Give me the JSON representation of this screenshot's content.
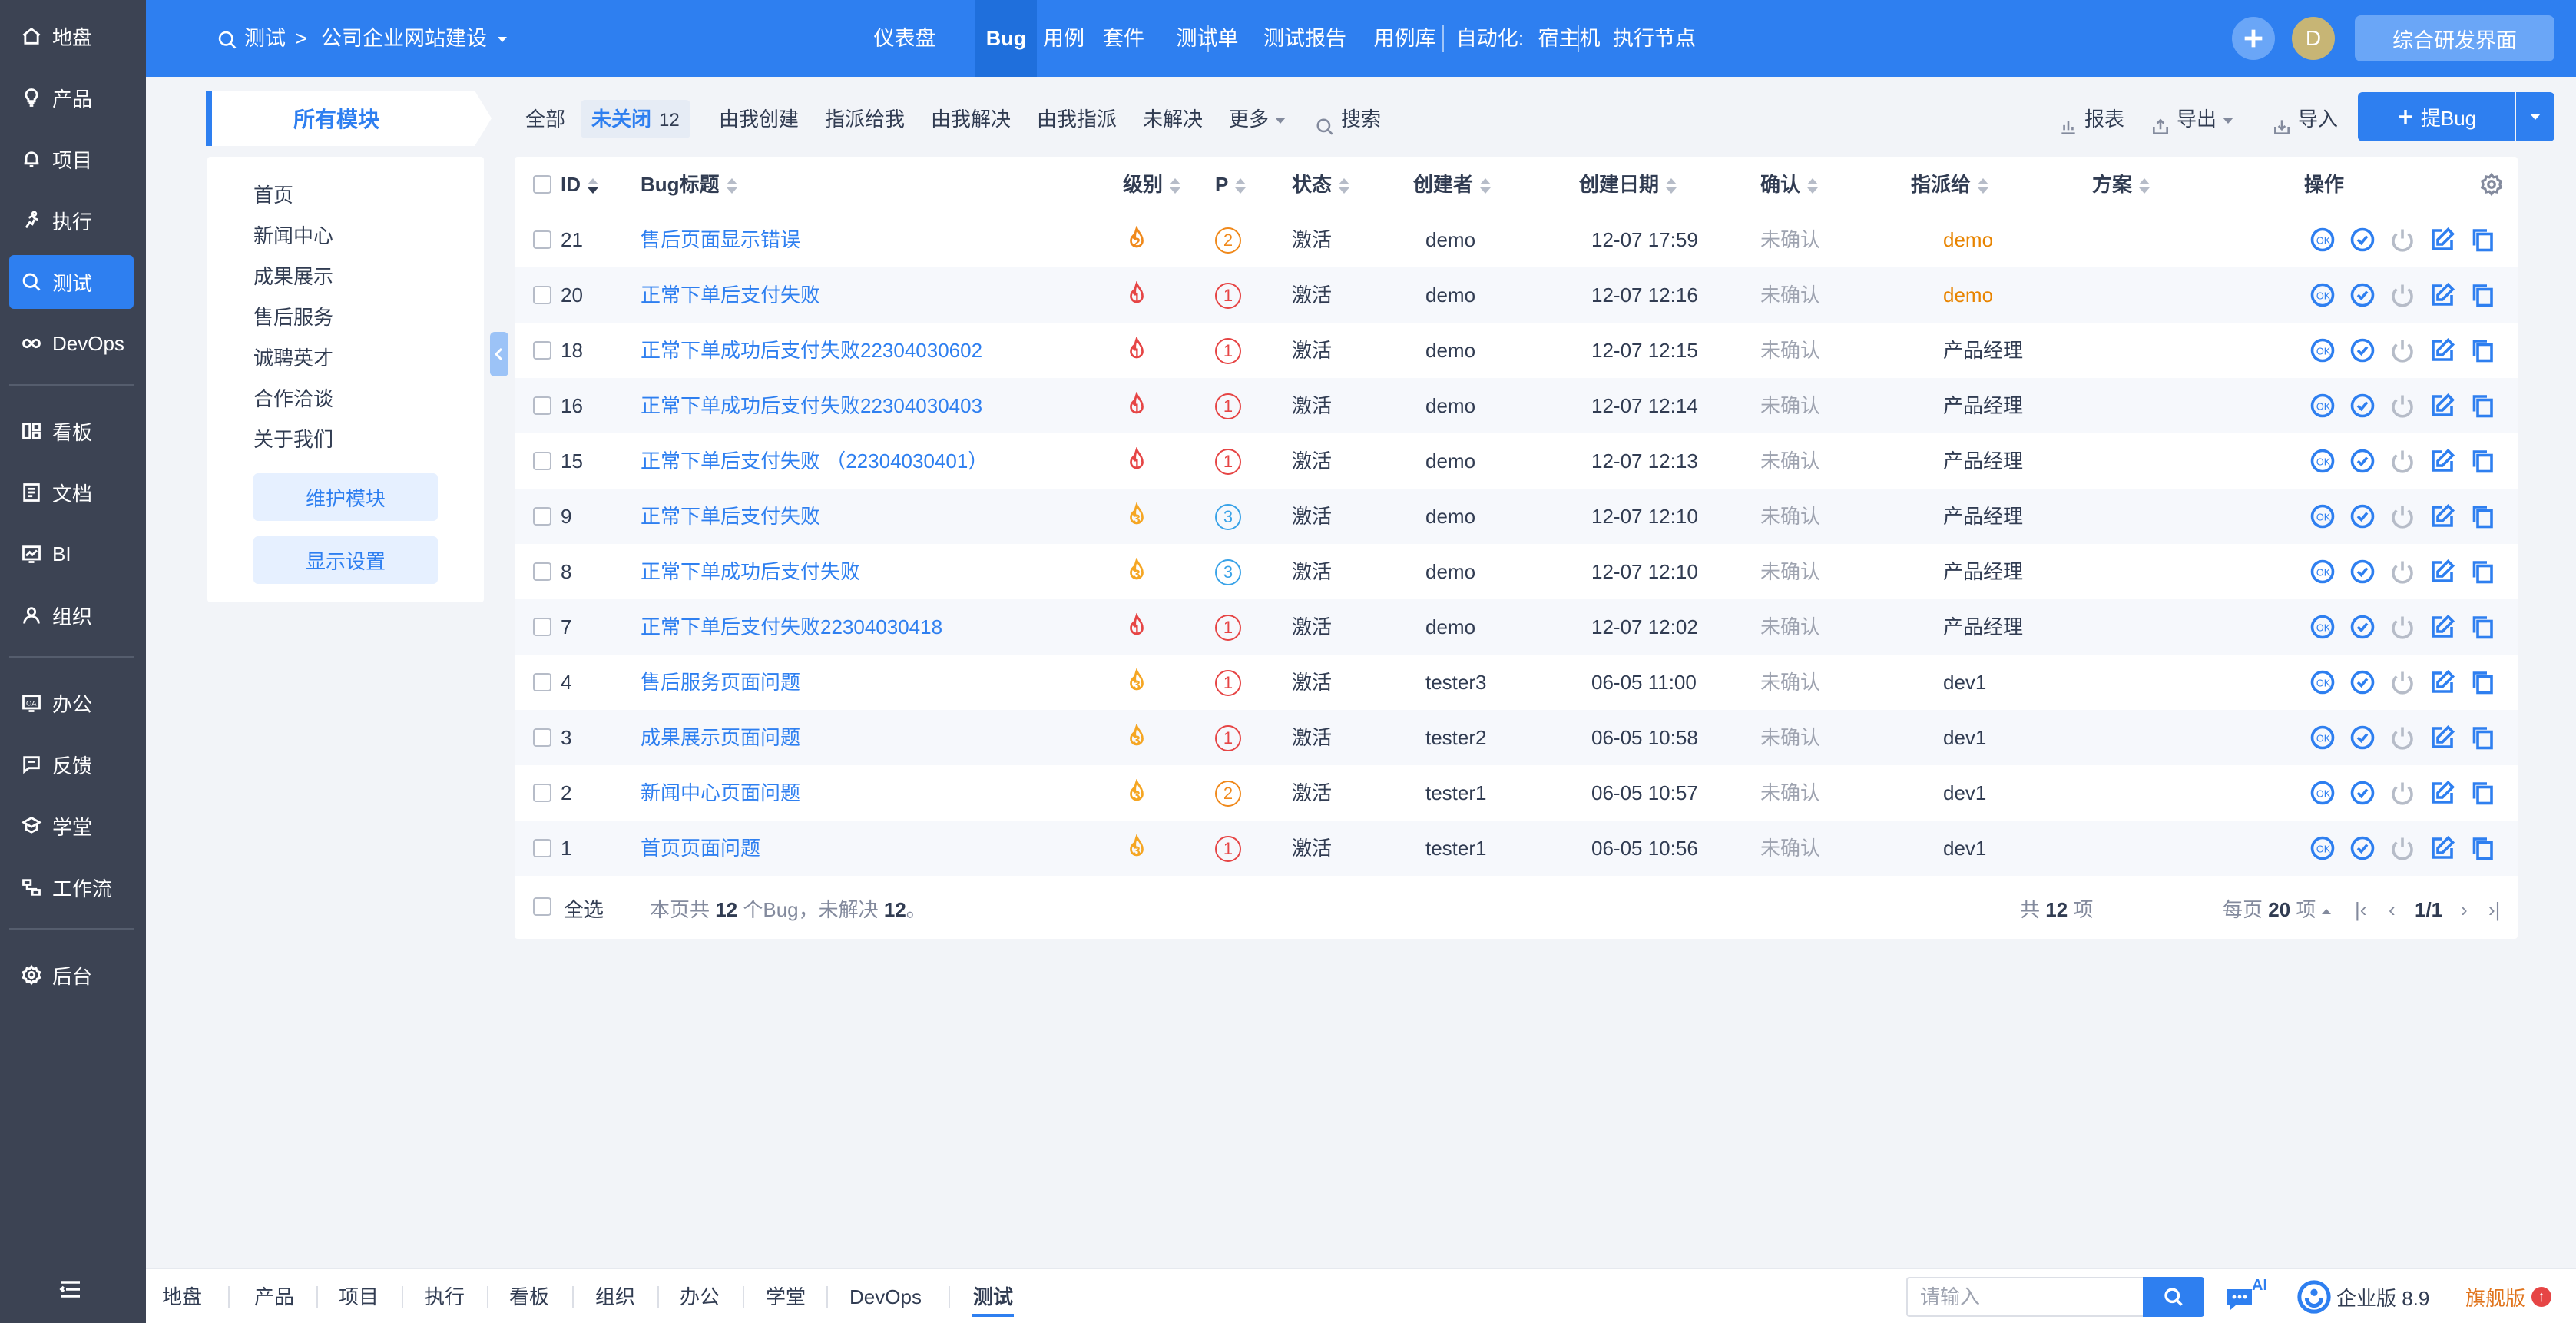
{
  "sidebar": {
    "items": [
      {
        "label": "地盘",
        "icon": "home-icon"
      },
      {
        "label": "产品",
        "icon": "lightbulb-icon"
      },
      {
        "label": "项目",
        "icon": "bell-icon"
      },
      {
        "label": "执行",
        "icon": "run-icon"
      },
      {
        "label": "测试",
        "icon": "search-icon",
        "active": true
      },
      {
        "label": "DevOps",
        "icon": "infinity-icon"
      },
      {
        "label": "看板",
        "icon": "board-icon"
      },
      {
        "label": "文档",
        "icon": "doc-icon"
      },
      {
        "label": "BI",
        "icon": "chart-icon"
      },
      {
        "label": "组织",
        "icon": "user-icon"
      },
      {
        "label": "办公",
        "icon": "oa-icon"
      },
      {
        "label": "反馈",
        "icon": "feedback-icon"
      },
      {
        "label": "学堂",
        "icon": "school-icon"
      },
      {
        "label": "工作流",
        "icon": "workflow-icon"
      },
      {
        "label": "后台",
        "icon": "gear-icon"
      }
    ]
  },
  "header": {
    "section": "测试",
    "breadcrumb_sep": ">",
    "project": "公司企业网站建设",
    "nav": [
      "仪表盘",
      "Bug",
      "用例",
      "套件",
      "测试单",
      "测试报告",
      "用例库",
      "自动化:",
      "宿主机",
      "执行节点"
    ],
    "active_nav": "Bug",
    "avatar": "D",
    "view_switch": "综合研发界面"
  },
  "modules": {
    "title": "所有模块",
    "items": [
      "首页",
      "新闻中心",
      "成果展示",
      "售后服务",
      "诚聘英才",
      "合作洽谈",
      "关于我们"
    ],
    "maintain_button": "维护模块",
    "display_button": "显示设置"
  },
  "filters": {
    "all": "全部",
    "unclosed": "未关闭",
    "unclosed_count": "12",
    "created_by_me": "由我创建",
    "assigned_to_me": "指派给我",
    "resolved_by_me": "由我解决",
    "assigned_by_me": "由我指派",
    "unresolved": "未解决",
    "more": "更多",
    "search": "搜索",
    "report": "报表",
    "export": "导出",
    "import": "导入",
    "create_bug": "提Bug"
  },
  "table": {
    "headers": {
      "id": "ID",
      "title": "Bug标题",
      "severity": "级别",
      "priority": "P",
      "status": "状态",
      "creator": "创建者",
      "date": "创建日期",
      "confirm": "确认",
      "assignee": "指派给",
      "resolution": "方案",
      "actions": "操作"
    },
    "rows": [
      {
        "id": "21",
        "title": "售后页面显示错误",
        "severity": 2,
        "priority": "2",
        "status": "激活",
        "creator": "demo",
        "date": "12-07 17:59",
        "confirm": "未确认",
        "assignee": "demo",
        "assignee_highlight": true
      },
      {
        "id": "20",
        "title": "正常下单后支付失败",
        "severity": 1,
        "priority": "1",
        "status": "激活",
        "creator": "demo",
        "date": "12-07 12:16",
        "confirm": "未确认",
        "assignee": "demo",
        "assignee_highlight": true
      },
      {
        "id": "18",
        "title": "正常下单成功后支付失败22304030602",
        "severity": 1,
        "priority": "1",
        "status": "激活",
        "creator": "demo",
        "date": "12-07 12:15",
        "confirm": "未确认",
        "assignee": "产品经理",
        "assignee_highlight": false
      },
      {
        "id": "16",
        "title": "正常下单成功后支付失败22304030403",
        "severity": 1,
        "priority": "1",
        "status": "激活",
        "creator": "demo",
        "date": "12-07 12:14",
        "confirm": "未确认",
        "assignee": "产品经理",
        "assignee_highlight": false
      },
      {
        "id": "15",
        "title": "正常下单后支付失败 （22304030401）",
        "severity": 1,
        "priority": "1",
        "status": "激活",
        "creator": "demo",
        "date": "12-07 12:13",
        "confirm": "未确认",
        "assignee": "产品经理",
        "assignee_highlight": false
      },
      {
        "id": "9",
        "title": "正常下单后支付失败",
        "severity": 3,
        "priority": "3",
        "status": "激活",
        "creator": "demo",
        "date": "12-07 12:10",
        "confirm": "未确认",
        "assignee": "产品经理",
        "assignee_highlight": false
      },
      {
        "id": "8",
        "title": "正常下单成功后支付失败",
        "severity": 3,
        "priority": "3",
        "status": "激活",
        "creator": "demo",
        "date": "12-07 12:10",
        "confirm": "未确认",
        "assignee": "产品经理",
        "assignee_highlight": false
      },
      {
        "id": "7",
        "title": "正常下单后支付失败22304030418",
        "severity": 1,
        "priority": "1",
        "status": "激活",
        "creator": "demo",
        "date": "12-07 12:02",
        "confirm": "未确认",
        "assignee": "产品经理",
        "assignee_highlight": false
      },
      {
        "id": "4",
        "title": "售后服务页面问题",
        "severity": 3,
        "priority": "1",
        "status": "激活",
        "creator": "tester3",
        "date": "06-05 11:00",
        "confirm": "未确认",
        "assignee": "dev1",
        "assignee_highlight": false
      },
      {
        "id": "3",
        "title": "成果展示页面问题",
        "severity": 3,
        "priority": "1",
        "status": "激活",
        "creator": "tester2",
        "date": "06-05 10:58",
        "confirm": "未确认",
        "assignee": "dev1",
        "assignee_highlight": false
      },
      {
        "id": "2",
        "title": "新闻中心页面问题",
        "severity": 3,
        "priority": "2",
        "status": "激活",
        "creator": "tester1",
        "date": "06-05 10:57",
        "confirm": "未确认",
        "assignee": "dev1",
        "assignee_highlight": false
      },
      {
        "id": "1",
        "title": "首页页面问题",
        "severity": 3,
        "priority": "1",
        "status": "激活",
        "creator": "tester1",
        "date": "06-05 10:56",
        "confirm": "未确认",
        "assignee": "dev1",
        "assignee_highlight": false
      }
    ],
    "action_icons": [
      "confirm-ok-icon",
      "resolve-check-icon",
      "close-power-icon",
      "edit-icon",
      "copy-icon"
    ]
  },
  "footer": {
    "select_all": "全选",
    "summary_prefix": "本页共 ",
    "summary_count": "12",
    "summary_mid": " 个Bug，未解决 ",
    "summary_unresolved": "12",
    "summary_suffix": "。",
    "total_prefix": "共 ",
    "total_count": "12",
    "total_suffix": " 项",
    "per_page_prefix": "每页 ",
    "per_page": "20",
    "per_page_suffix": " 项",
    "page_info": "1/1"
  },
  "bottombar": {
    "tabs": [
      "地盘",
      "产品",
      "项目",
      "执行",
      "看板",
      "组织",
      "办公",
      "学堂",
      "DevOps",
      "测试"
    ],
    "active_tab": "测试",
    "search_placeholder": "请输入",
    "ai_badge": "AI",
    "edition": "企业版 8.9",
    "upgrade": "旗舰版"
  },
  "colors": {
    "primary": "#2e7ff0",
    "sidebar": "#3c4353",
    "severity_high": "#e64545",
    "severity_mid": "#f0891b",
    "severity_low": "#f5a623",
    "priority_3": "#3aa3e8",
    "assignee_highlight": "#e88400"
  }
}
